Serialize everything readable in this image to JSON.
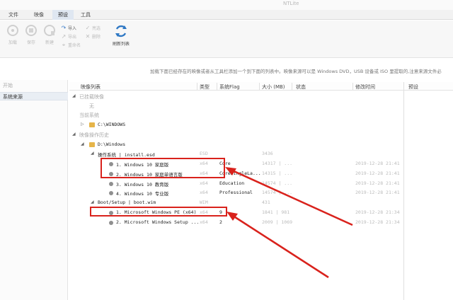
{
  "window": {
    "title": "NTLite"
  },
  "menu": [
    {
      "label": "文件",
      "active": false
    },
    {
      "label": "映像",
      "active": false
    },
    {
      "label": "预设",
      "active": true
    },
    {
      "label": "工具",
      "active": false
    }
  ],
  "ribbon": {
    "buttons": [
      {
        "label": "加载",
        "icon": "load-icon"
      },
      {
        "label": "保存",
        "icon": "save-icon"
      },
      {
        "label": "新建",
        "icon": "new-icon"
      }
    ],
    "small": [
      {
        "label": "导入",
        "icon": "import-arrow-icon",
        "enabled": true
      },
      {
        "label": "导出",
        "icon": "export-arrow-icon",
        "enabled": false
      },
      {
        "label": "重命名",
        "icon": "rename-icon",
        "enabled": false
      },
      {
        "label": "亮选",
        "icon": "select-icon",
        "enabled": false
      },
      {
        "label": "删除",
        "icon": "delete-icon",
        "enabled": false
      }
    ],
    "refresh": {
      "label": "刷新列表",
      "icon": "refresh-icon"
    }
  },
  "notice": "加载下面已经存在的映像或者从工具栏添加一个到下面的列表中。映像来源可以是 Windows DVD，USB 设备或 ISO 里提取的,注意来源文件必",
  "left_pane": {
    "header": "开始",
    "items": [
      "系统来源"
    ]
  },
  "columns": {
    "name": "映像列表",
    "type": "类型",
    "flag": "系统Flag",
    "size": "大小 (MB)",
    "status": "状态",
    "modified": "修改时间",
    "details": "预设"
  },
  "tree": {
    "loaded_group": "已挂载映像",
    "loaded_none": "无",
    "current_group": "当前系统",
    "current_path": "C:\\WINDOWS",
    "history_group": "映像操作历史",
    "history_path": "D:\\Windows",
    "os_group": {
      "label": "操作系统  |  install.esd",
      "type": "ESD",
      "size": "3436"
    },
    "os_images": [
      {
        "name": "1. Windows 10 家庭版",
        "arch": "x64",
        "flag": "Core",
        "size": "14317 | ...",
        "date": "2019-12-28 21:41"
      },
      {
        "name": "2. Windows 10 家庭单语言版",
        "arch": "x64",
        "flag": "CoreSingleLa...",
        "size": "14315 | ...",
        "date": "2019-12-28 21:41"
      },
      {
        "name": "3. Windows 10 教育版",
        "arch": "x64",
        "flag": "Education",
        "size": "14574 | ...",
        "date": "2019-12-28 21:41"
      },
      {
        "name": "4. Windows 10 专业版",
        "arch": "x64",
        "flag": "Professional",
        "size": "14574 | ...",
        "date": "2019-12-28 21:41"
      }
    ],
    "boot_group": {
      "label": "Boot/Setup  |  boot.wim",
      "type": "WIM",
      "size": "431"
    },
    "boot_images": [
      {
        "name": "1. Microsoft Windows PE (x64)",
        "arch": "x64",
        "flag": "9",
        "size": "1841 | 981",
        "date": "2019-12-28 21:34"
      },
      {
        "name": "2. Microsoft Windows Setup ...",
        "arch": "x64",
        "flag": "2",
        "size": "2009 | 1069",
        "date": "2019-12-28 21:34"
      }
    ]
  },
  "colors": {
    "highlight": "#d9221c",
    "folder": "#e6b54a",
    "accent_tab": "#dfe7f1"
  }
}
